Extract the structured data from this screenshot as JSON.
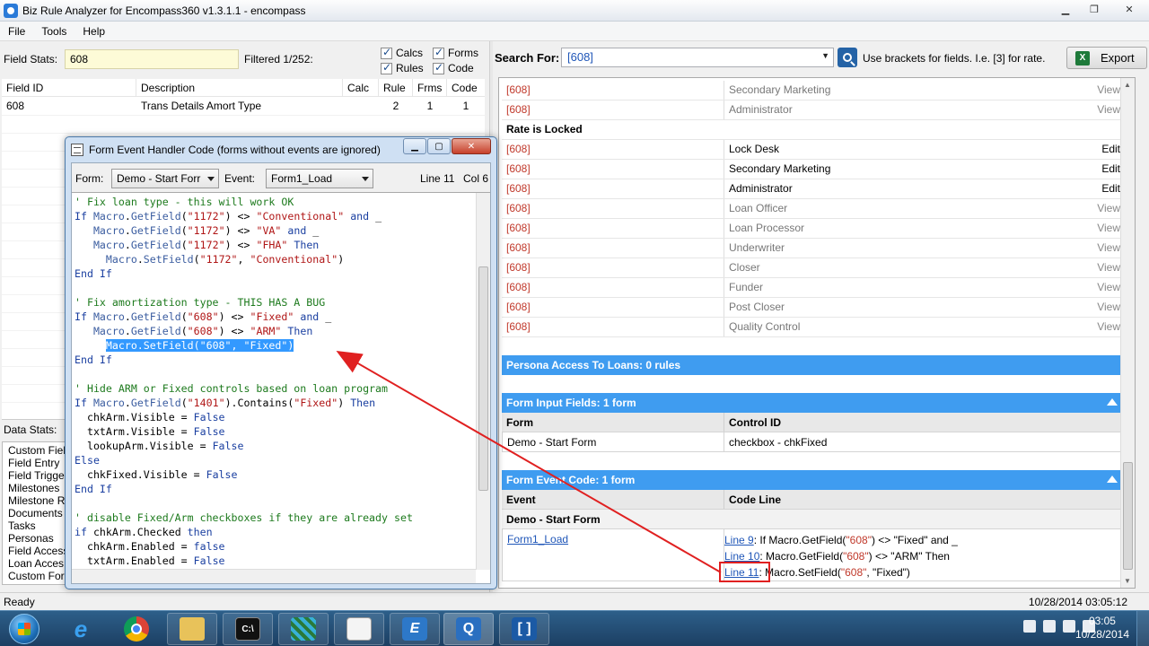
{
  "window": {
    "title": "Biz Rule Analyzer for Encompass360 v1.3.1.1 - encompass"
  },
  "menu": [
    "File",
    "Tools",
    "Help"
  ],
  "left": {
    "field_stats_label": "Field Stats:",
    "field_stats_value": "608",
    "filtered": "Filtered 1/252:",
    "checks": [
      {
        "label": "Calcs"
      },
      {
        "label": "Forms"
      },
      {
        "label": "Rules"
      },
      {
        "label": "Code"
      }
    ],
    "columns": [
      "Field ID",
      "Description",
      "Calc",
      "Rule",
      "Frms",
      "Code"
    ],
    "rows": [
      {
        "field_id": "608",
        "description": "Trans Details Amort Type",
        "calc": "",
        "rule": "2",
        "frms": "1",
        "code": "1"
      }
    ],
    "data_stats_label": "Data Stats:",
    "data_items": [
      "Custom Fiel",
      "Field Entry",
      "Field Trigge",
      "Milestones",
      "Milestone R",
      "Documents",
      "Tasks",
      "Personas",
      "Field Access",
      "Loan Acces",
      "Custom For"
    ]
  },
  "form_window": {
    "title": "Form Event Handler Code (forms without events are ignored)",
    "form_label": "Form:",
    "form_value": "Demo - Start Forr",
    "event_label": "Event:",
    "event_value": "Form1_Load",
    "line": "Line 11",
    "col": "Col 6"
  },
  "right": {
    "search_label": "Search For:",
    "search_value": "[608]",
    "hint": "Use brackets for fields.  I.e. [3] for rate.",
    "export_label": "Export",
    "top_rows": [
      {
        "field": "[608]",
        "persona": "Secondary Marketing",
        "action": "View"
      },
      {
        "field": "[608]",
        "persona": "Administrator",
        "action": "View"
      }
    ],
    "group_title": "Rate is Locked",
    "locked_rows": [
      {
        "field": "[608]",
        "persona": "Lock Desk",
        "action": "Edit"
      },
      {
        "field": "[608]",
        "persona": "Secondary Marketing",
        "action": "Edit"
      },
      {
        "field": "[608]",
        "persona": "Administrator",
        "action": "Edit"
      },
      {
        "field": "[608]",
        "persona": "Loan Officer",
        "action": "View"
      },
      {
        "field": "[608]",
        "persona": "Loan Processor",
        "action": "View"
      },
      {
        "field": "[608]",
        "persona": "Underwriter",
        "action": "View"
      },
      {
        "field": "[608]",
        "persona": "Closer",
        "action": "View"
      },
      {
        "field": "[608]",
        "persona": "Funder",
        "action": "View"
      },
      {
        "field": "[608]",
        "persona": "Post Closer",
        "action": "View"
      },
      {
        "field": "[608]",
        "persona": "Quality Control",
        "action": "View"
      }
    ],
    "persona_access": "Persona Access To Loans: 0 rules",
    "form_input_fields": "Form Input Fields: 1 form",
    "fif_headers": [
      "Form",
      "Control ID"
    ],
    "fif_row": {
      "form": "Demo - Start Form",
      "control": "checkbox - chkFixed"
    },
    "form_event_code": "Form Event Code: 1 form",
    "fec_headers": [
      "Event",
      "Code Line"
    ],
    "fec_group": "Demo - Start Form",
    "fec_event": "Form1_Load",
    "code_lines": [
      {
        "link": "Line 9",
        "pre": ": If Macro.GetField(",
        "str1": "\"608\"",
        "post": ") <> \"Fixed\" and _"
      },
      {
        "link": "Line 10",
        "pre": ": Macro.GetField(",
        "str1": "\"608\"",
        "post": ") <> \"ARM\" Then"
      },
      {
        "link": "Line 11",
        "pre": ": Macro.SetField(",
        "str1": "\"608\"",
        "post": ", \"Fixed\")"
      }
    ]
  },
  "status": {
    "left": "Ready",
    "right": "10/28/2014 03:05:12"
  },
  "taskbar": {
    "time": "03:05",
    "date": "10/28/2014"
  },
  "colors": {
    "accent": "#3f9cf0",
    "field_red": "#c0392b",
    "annotation_red": "#e02020"
  }
}
